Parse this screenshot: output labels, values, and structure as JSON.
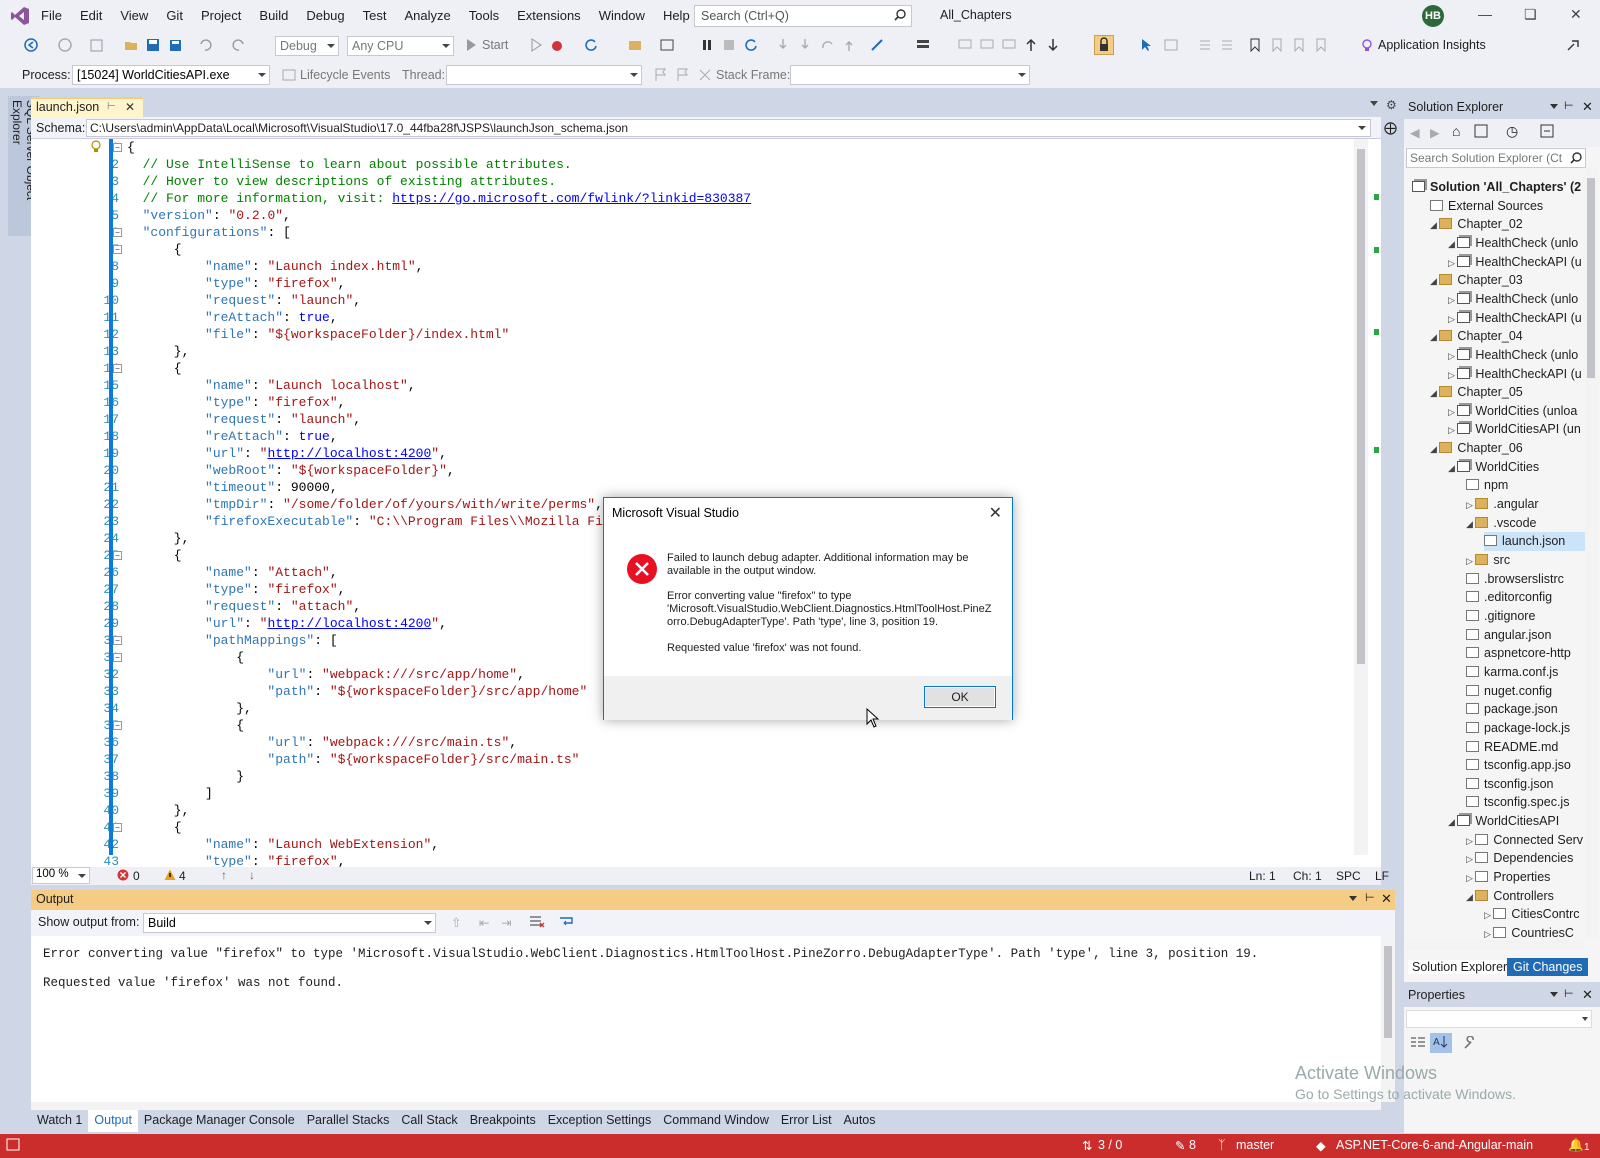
{
  "menu": {
    "items": [
      "File",
      "Edit",
      "View",
      "Git",
      "Project",
      "Build",
      "Debug",
      "Test",
      "Analyze",
      "Tools",
      "Extensions",
      "Window",
      "Help"
    ]
  },
  "search": {
    "placeholder": "Search (Ctrl+Q)"
  },
  "solution_name": "All_Chapters",
  "user_initials": "HB",
  "toolbar": {
    "config": "Debug",
    "platform": "Any CPU",
    "start_label": "Start",
    "app_insights": "Application Insights",
    "process_label": "Process:",
    "process_value": "[15024] WorldCitiesAPI.exe",
    "lifecycle_label": "Lifecycle Events",
    "thread_label": "Thread:",
    "stackframe_label": "Stack Frame:"
  },
  "sql_explorer_tab": "SQL Server Object Explorer",
  "document_tab": "launch.json",
  "schema": {
    "label": "Schema:",
    "path": "C:\\Users\\admin\\AppData\\Local\\Microsoft\\VisualStudio\\17.0_44fba28f\\JSPS\\launchJson_schema.json"
  },
  "editor_status": {
    "zoom": "100 %",
    "errors": "0",
    "warnings": "4",
    "line": "Ln: 1",
    "col": "Ch: 1",
    "spc": "SPC",
    "eol": "LF"
  },
  "output": {
    "title": "Output",
    "show_from_label": "Show output from:",
    "source": "Build",
    "line1": "Error converting value \"firefox\" to type 'Microsoft.VisualStudio.WebClient.Diagnostics.HtmlToolHost.PineZorro.DebugAdapterType'. Path 'type', line 3, position 19.",
    "line2": "Requested value 'firefox' was not found."
  },
  "bottom_tabs": [
    "Watch 1",
    "Output",
    "Package Manager Console",
    "Parallel Stacks",
    "Call Stack",
    "Breakpoints",
    "Exception Settings",
    "Command Window",
    "Error List",
    "Autos"
  ],
  "solution_explorer": {
    "title": "Solution Explorer",
    "search_placeholder": "Search Solution Explorer (Ct",
    "items": [
      "Solution 'All_Chapters' (2",
      "External Sources",
      "Chapter_02",
      "HealthCheck (unlo",
      "HealthCheckAPI (u",
      "Chapter_03",
      "HealthCheck (unlo",
      "HealthCheckAPI (u",
      "Chapter_04",
      "HealthCheck (unlo",
      "HealthCheckAPI (u",
      "Chapter_05",
      "WorldCities (unloa",
      "WorldCitiesAPI (un",
      "Chapter_06",
      "WorldCities",
      "npm",
      ".angular",
      ".vscode",
      "launch.json",
      "src",
      ".browserslistrc",
      ".editorconfig",
      ".gitignore",
      "angular.json",
      "aspnetcore-http",
      "karma.conf.js",
      "nuget.config",
      "package.json",
      "package-lock.js",
      "README.md",
      "tsconfig.app.jso",
      "tsconfig.json",
      "tsconfig.spec.js",
      "WorldCitiesAPI",
      "Connected Serv",
      "Dependencies",
      "Properties",
      "Controllers",
      "CitiesContrc",
      "CountriesC"
    ],
    "tab_solution": "Solution Explorer",
    "tab_git": "Git Changes"
  },
  "properties": {
    "title": "Properties"
  },
  "watermark": {
    "line1": "Activate Windows",
    "line2": "Go to Settings to activate Windows."
  },
  "statusbar": {
    "lines": "3 / 0",
    "pencil": "8",
    "branch": "master",
    "repo": "ASP.NET-Core-6-and-Angular-main",
    "notif": "1"
  },
  "dialog": {
    "title": "Microsoft Visual Studio",
    "msg1": "Failed to launch debug adapter.  Additional information may be available in the output window.",
    "msg2": "Error converting value \"firefox\" to type 'Microsoft.VisualStudio.WebClient.Diagnostics.HtmlToolHost.PineZorro.DebugAdapterType'. Path 'type', line 3, position 19.",
    "msg3": "Requested value 'firefox' was not found.",
    "ok": "OK"
  },
  "code_lines": [
    [
      [
        "p",
        "{"
      ]
    ],
    [
      [
        "cm",
        "  // Use IntelliSense to learn about possible attributes."
      ]
    ],
    [
      [
        "cm",
        "  // Hover to view descriptions of existing attributes."
      ]
    ],
    [
      [
        "cm",
        "  // For more information, visit: "
      ],
      [
        "link",
        "https://go.microsoft.com/fwlink/?linkid=830387"
      ]
    ],
    [
      [
        "key",
        "  \"version\""
      ],
      [
        "p",
        ": "
      ],
      [
        "str",
        "\"0.2.0\""
      ],
      [
        "p",
        ","
      ]
    ],
    [
      [
        "key",
        "  \"configurations\""
      ],
      [
        "p",
        ": ["
      ]
    ],
    [
      [
        "p",
        "      {"
      ]
    ],
    [
      [
        "key",
        "          \"name\""
      ],
      [
        "p",
        ": "
      ],
      [
        "str",
        "\"Launch index.html\""
      ],
      [
        "p",
        ","
      ]
    ],
    [
      [
        "key",
        "          \"type\""
      ],
      [
        "p",
        ": "
      ],
      [
        "str",
        "\"firefox\""
      ],
      [
        "p",
        ","
      ]
    ],
    [
      [
        "key",
        "          \"request\""
      ],
      [
        "p",
        ": "
      ],
      [
        "str",
        "\"launch\""
      ],
      [
        "p",
        ","
      ]
    ],
    [
      [
        "key",
        "          \"reAttach\""
      ],
      [
        "p",
        ": "
      ],
      [
        "lit",
        "true"
      ],
      [
        "p",
        ","
      ]
    ],
    [
      [
        "key",
        "          \"file\""
      ],
      [
        "p",
        ": "
      ],
      [
        "str",
        "\"${workspaceFolder}/index.html\""
      ]
    ],
    [
      [
        "p",
        "      },"
      ]
    ],
    [
      [
        "p",
        "      {"
      ]
    ],
    [
      [
        "key",
        "          \"name\""
      ],
      [
        "p",
        ": "
      ],
      [
        "str",
        "\"Launch localhost\""
      ],
      [
        "p",
        ","
      ]
    ],
    [
      [
        "key",
        "          \"type\""
      ],
      [
        "p",
        ": "
      ],
      [
        "str",
        "\"firefox\""
      ],
      [
        "p",
        ","
      ]
    ],
    [
      [
        "key",
        "          \"request\""
      ],
      [
        "p",
        ": "
      ],
      [
        "str",
        "\"launch\""
      ],
      [
        "p",
        ","
      ]
    ],
    [
      [
        "key",
        "          \"reAttach\""
      ],
      [
        "p",
        ": "
      ],
      [
        "lit",
        "true"
      ],
      [
        "p",
        ","
      ]
    ],
    [
      [
        "key",
        "          \"url\""
      ],
      [
        "p",
        ": "
      ],
      [
        "str",
        "\""
      ],
      [
        "link",
        "http://localhost:4200"
      ],
      [
        "str",
        "\""
      ],
      [
        "p",
        ","
      ]
    ],
    [
      [
        "key",
        "          \"webRoot\""
      ],
      [
        "p",
        ": "
      ],
      [
        "str",
        "\"${workspaceFolder}\""
      ],
      [
        "p",
        ","
      ]
    ],
    [
      [
        "key",
        "          \"timeout\""
      ],
      [
        "p",
        ": "
      ],
      [
        "p",
        "90000"
      ],
      [
        "p",
        ","
      ]
    ],
    [
      [
        "key",
        "          \"tmpDir\""
      ],
      [
        "p",
        ": "
      ],
      [
        "str",
        "\"/some/folder/of/yours/with/write/perms\""
      ],
      [
        "p",
        ","
      ]
    ],
    [
      [
        "key",
        "          \"firefoxExecutable\""
      ],
      [
        "p",
        ": "
      ],
      [
        "str",
        "\"C:\\\\Program Files\\\\Mozilla Fire"
      ]
    ],
    [
      [
        "p",
        "      },"
      ]
    ],
    [
      [
        "p",
        "      {"
      ]
    ],
    [
      [
        "key",
        "          \"name\""
      ],
      [
        "p",
        ": "
      ],
      [
        "str",
        "\"Attach\""
      ],
      [
        "p",
        ","
      ]
    ],
    [
      [
        "key",
        "          \"type\""
      ],
      [
        "p",
        ": "
      ],
      [
        "str",
        "\"firefox\""
      ],
      [
        "p",
        ","
      ]
    ],
    [
      [
        "key",
        "          \"request\""
      ],
      [
        "p",
        ": "
      ],
      [
        "str",
        "\"attach\""
      ],
      [
        "p",
        ","
      ]
    ],
    [
      [
        "key",
        "          \"url\""
      ],
      [
        "p",
        ": "
      ],
      [
        "str",
        "\""
      ],
      [
        "link",
        "http://localhost:4200"
      ],
      [
        "str",
        "\""
      ],
      [
        "p",
        ","
      ]
    ],
    [
      [
        "key",
        "          \"pathMappings\""
      ],
      [
        "p",
        ": ["
      ]
    ],
    [
      [
        "p",
        "              {"
      ]
    ],
    [
      [
        "key",
        "                  \"url\""
      ],
      [
        "p",
        ": "
      ],
      [
        "str",
        "\"webpack:///src/app/home\""
      ],
      [
        "p",
        ","
      ]
    ],
    [
      [
        "key",
        "                  \"path\""
      ],
      [
        "p",
        ": "
      ],
      [
        "str",
        "\"${workspaceFolder}/src/app/home\""
      ]
    ],
    [
      [
        "p",
        "              },"
      ]
    ],
    [
      [
        "p",
        "              {"
      ]
    ],
    [
      [
        "key",
        "                  \"url\""
      ],
      [
        "p",
        ": "
      ],
      [
        "str",
        "\"webpack:///src/main.ts\""
      ],
      [
        "p",
        ","
      ]
    ],
    [
      [
        "key",
        "                  \"path\""
      ],
      [
        "p",
        ": "
      ],
      [
        "str",
        "\"${workspaceFolder}/src/main.ts\""
      ]
    ],
    [
      [
        "p",
        "              }"
      ]
    ],
    [
      [
        "p",
        "          ]"
      ]
    ],
    [
      [
        "p",
        "      },"
      ]
    ],
    [
      [
        "p",
        "      {"
      ]
    ],
    [
      [
        "key",
        "          \"name\""
      ],
      [
        "p",
        ": "
      ],
      [
        "str",
        "\"Launch WebExtension\""
      ],
      [
        "p",
        ","
      ]
    ],
    [
      [
        "key",
        "          \"type\""
      ],
      [
        "p",
        ": "
      ],
      [
        "str",
        "\"firefox\""
      ],
      [
        "p",
        ","
      ]
    ]
  ]
}
